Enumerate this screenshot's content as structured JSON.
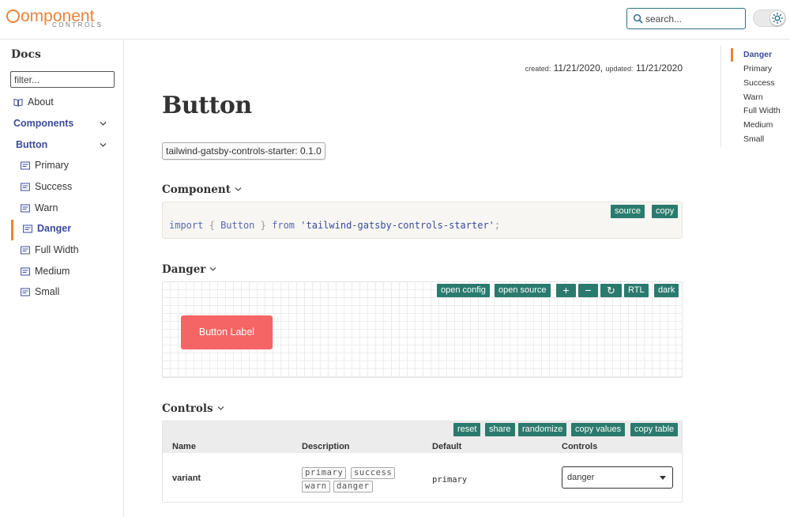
{
  "header": {
    "logo_main": "omponent",
    "logo_sub": "CONTROLS",
    "search_placeholder": "search..."
  },
  "sidebar": {
    "title": "Docs",
    "filter_placeholder": "filter...",
    "items": [
      {
        "label": "About",
        "icon": "book-icon"
      },
      {
        "label": "Components",
        "icon": "",
        "expanded": true
      },
      {
        "label": "Button",
        "icon": "",
        "expanded": true
      },
      {
        "label": "Primary",
        "icon": "page-icon"
      },
      {
        "label": "Success",
        "icon": "page-icon"
      },
      {
        "label": "Warn",
        "icon": "page-icon"
      },
      {
        "label": "Danger",
        "icon": "page-icon",
        "active": true
      },
      {
        "label": "Full Width",
        "icon": "page-icon"
      },
      {
        "label": "Medium",
        "icon": "page-icon"
      },
      {
        "label": "Small",
        "icon": "page-icon"
      }
    ]
  },
  "meta": {
    "created_label": "created:",
    "created": "11/21/2020,",
    "updated_label": "updated:",
    "updated": "11/21/2020"
  },
  "page": {
    "title": "Button",
    "package_badge": "tailwind-gatsby-controls-starter: 0.1.0"
  },
  "component_section": {
    "title": "Component",
    "code_kw_import": "import",
    "code_open": "{",
    "code_name": "Button",
    "code_close": "}",
    "code_kw_from": "from",
    "code_str": "'tailwind-gatsby-controls-starter'",
    "code_semi": ";",
    "buttons": [
      "source",
      "copy"
    ]
  },
  "story_section": {
    "title": "Danger",
    "toolbar": [
      "open config",
      "open source",
      "+",
      "−",
      "↻",
      "RTL",
      "dark"
    ],
    "demo_button_label": "Button Label"
  },
  "controls_section": {
    "title": "Controls",
    "toolbar": [
      "reset",
      "share",
      "randomize",
      "copy values",
      "copy table"
    ],
    "columns": [
      "Name",
      "Description",
      "Default",
      "Controls"
    ],
    "row": {
      "name": "variant",
      "options": [
        "primary",
        "success",
        "warn",
        "danger"
      ],
      "default": "primary",
      "selected": "danger"
    }
  },
  "toc": {
    "items": [
      "Danger",
      "Primary",
      "Success",
      "Warn",
      "Full Width",
      "Medium",
      "Small"
    ],
    "active": "Danger"
  },
  "colors": {
    "accent_orange": "#e8833a",
    "nav_blue": "#3b4b9b",
    "toolbar_teal": "#2b7a6e",
    "danger_red": "#f56565"
  }
}
